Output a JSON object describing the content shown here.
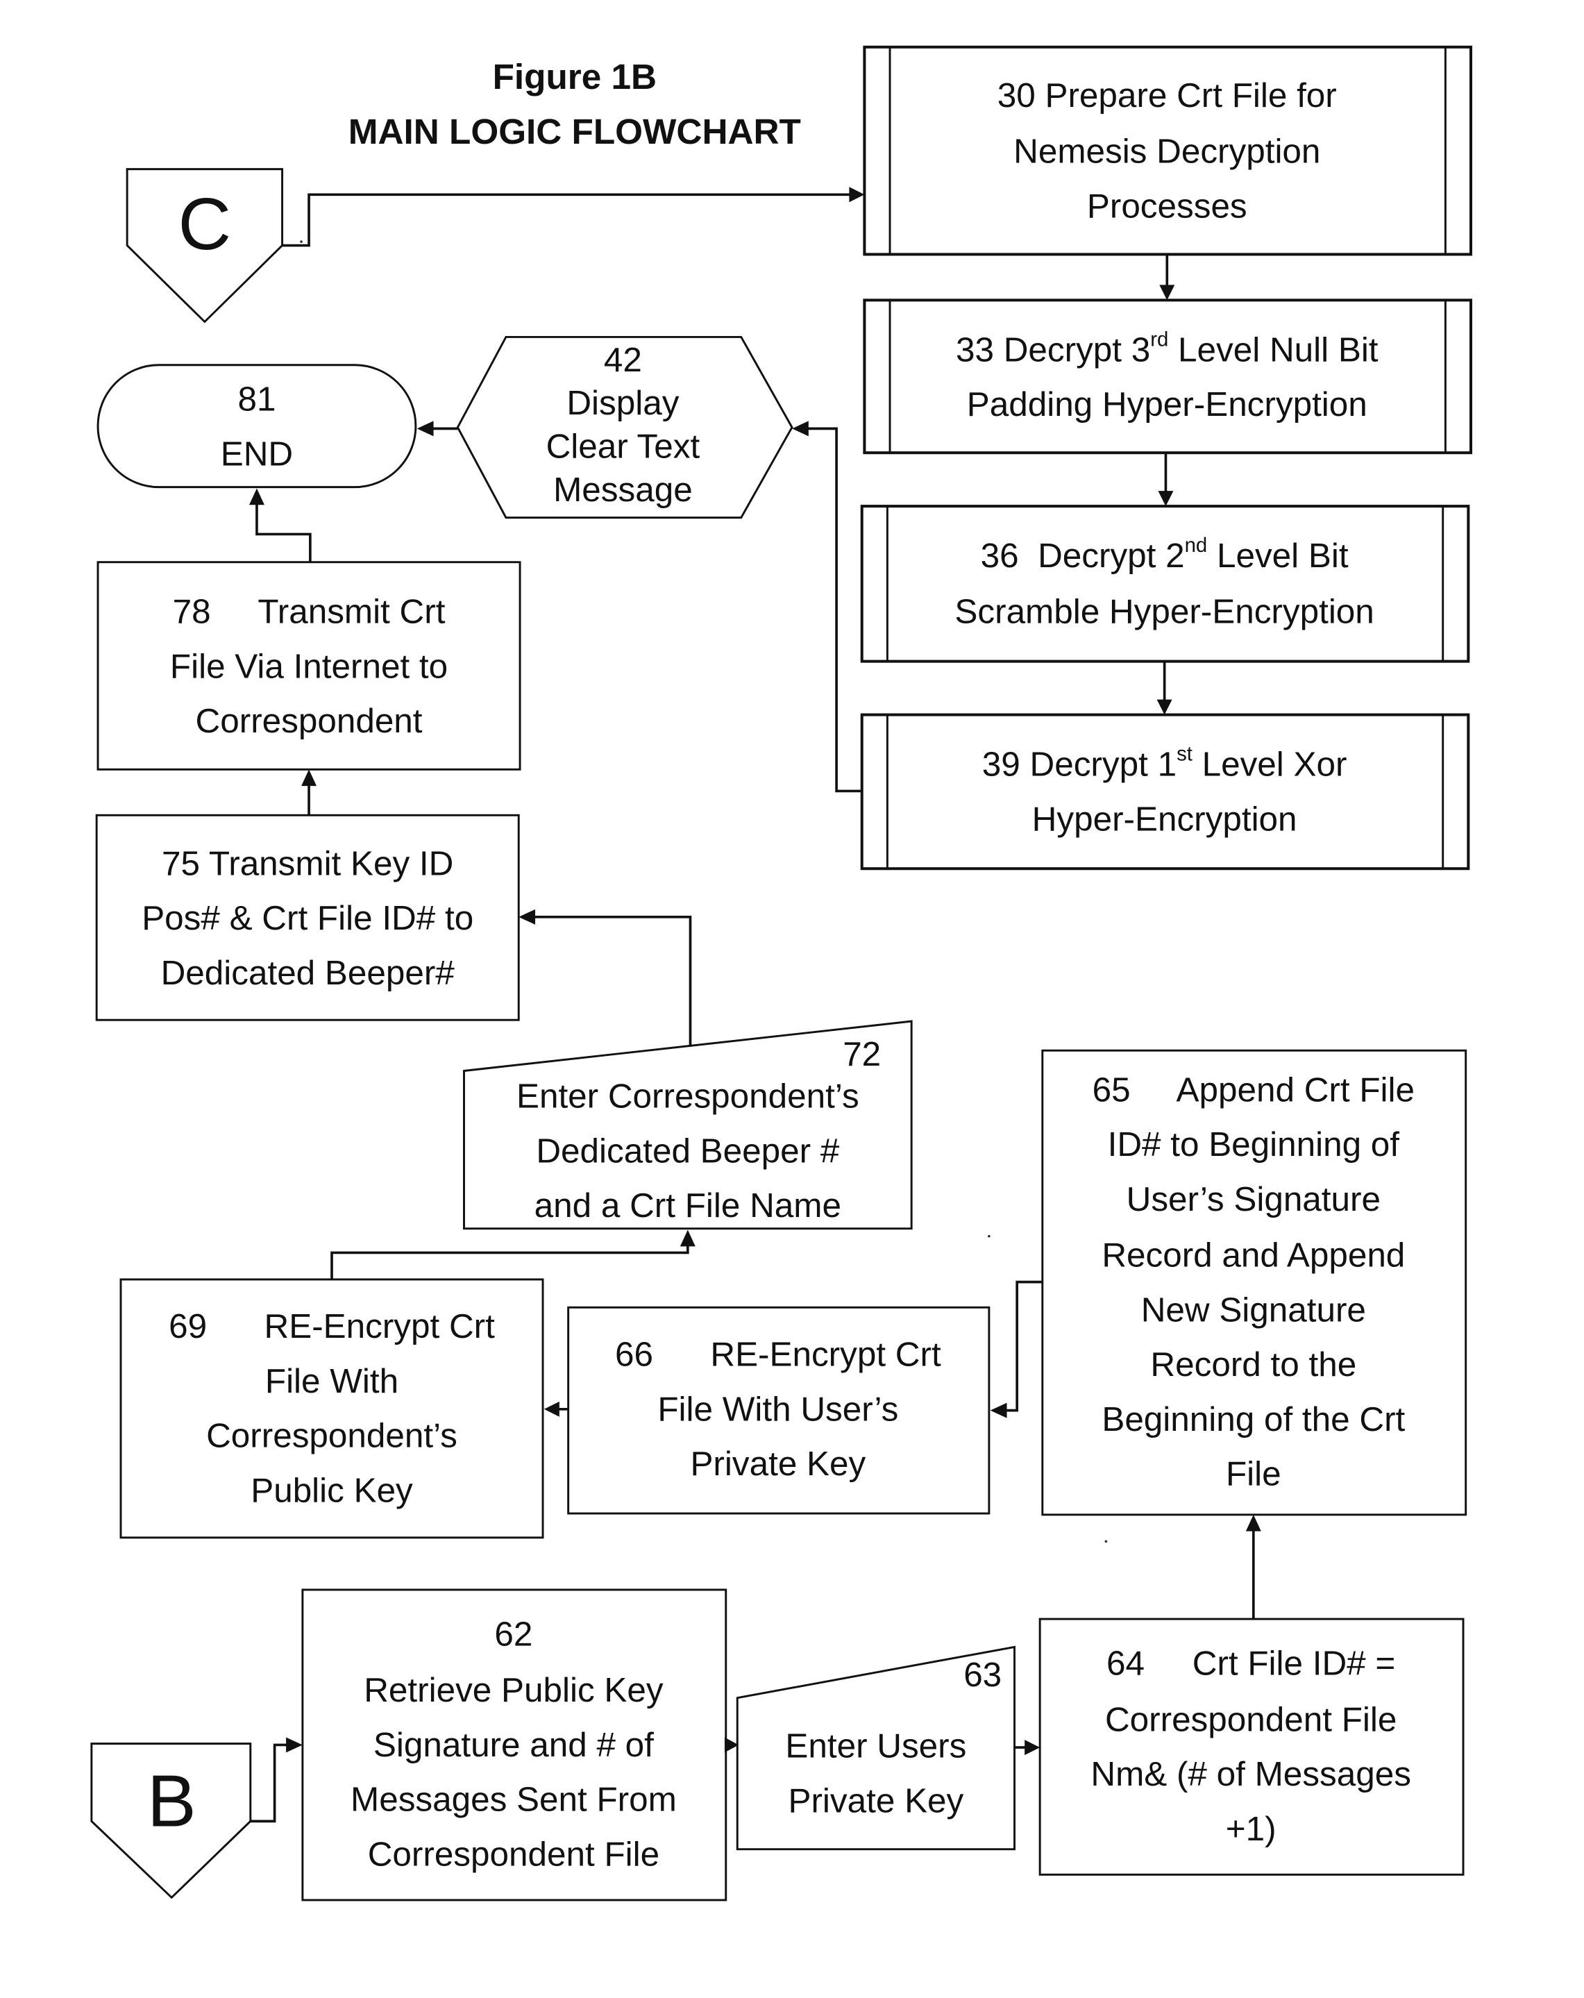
{
  "figure": {
    "title": "Figure 1B",
    "subtitle": "MAIN LOGIC FLOWCHART"
  },
  "connectors": {
    "c": {
      "label": "C"
    },
    "b": {
      "label": "B"
    }
  },
  "nodes": {
    "n30": {
      "id": "30",
      "type": "predefined-process",
      "lines": [
        "30 Prepare Crt File for",
        "Nemesis Decryption",
        "Processes"
      ]
    },
    "n33": {
      "id": "33",
      "type": "predefined-process",
      "line1_pre": "33 Decrypt 3",
      "line1_sup": "rd",
      "line1_post": " Level Null Bit",
      "line2": "Padding Hyper-Encryption"
    },
    "n36": {
      "id": "36",
      "type": "predefined-process",
      "line1_pre": "36  Decrypt 2",
      "line1_sup": "nd",
      "line1_post": " Level Bit",
      "line2": "Scramble Hyper-Encryption"
    },
    "n39": {
      "id": "39",
      "type": "predefined-process",
      "line1_pre": "39 Decrypt 1",
      "line1_sup": "st",
      "line1_post": " Level Xor",
      "line2": "Hyper-Encryption"
    },
    "n42": {
      "id": "42",
      "type": "display",
      "lines": [
        "42",
        "Display",
        "Clear Text",
        "Message"
      ]
    },
    "n81": {
      "id": "81",
      "type": "terminal",
      "lines": [
        "81",
        "END"
      ]
    },
    "n78": {
      "id": "78",
      "type": "process",
      "lines": [
        "78     Transmit Crt",
        "File Via Internet to",
        "Correspondent"
      ]
    },
    "n75": {
      "id": "75",
      "type": "process",
      "lines": [
        "75 Transmit Key ID",
        "Pos# & Crt File ID# to",
        "Dedicated Beeper#"
      ]
    },
    "n72": {
      "id": "72",
      "type": "manual-input",
      "number": "72",
      "lines": [
        "Enter Correspondent’s",
        "Dedicated Beeper #",
        "and a Crt File Name"
      ]
    },
    "n65": {
      "id": "65",
      "type": "process",
      "lines": [
        "65     Append Crt File",
        "ID# to Beginning of",
        "User’s Signature",
        "Record and Append",
        "New Signature",
        "Record to the",
        "Beginning of the Crt",
        "File"
      ]
    },
    "n69": {
      "id": "69",
      "type": "process",
      "lines": [
        "69      RE-Encrypt Crt",
        "File With",
        "Correspondent’s",
        "Public Key"
      ]
    },
    "n66": {
      "id": "66",
      "type": "process",
      "lines": [
        "66      RE-Encrypt Crt",
        "File With User’s",
        "Private Key"
      ]
    },
    "n62": {
      "id": "62",
      "type": "process",
      "lines": [
        "62",
        "Retrieve Public Key",
        "Signature and # of",
        "Messages Sent From",
        "Correspondent File"
      ]
    },
    "n63": {
      "id": "63",
      "type": "manual-input",
      "number": "63",
      "lines": [
        "Enter Users",
        "Private Key"
      ]
    },
    "n64": {
      "id": "64",
      "type": "process",
      "lines": [
        "64     Crt File ID# =",
        "Correspondent File",
        "Nm& (# of Messages",
        "+1)"
      ]
    }
  },
  "edges": [
    {
      "from": "C",
      "to": "30"
    },
    {
      "from": "30",
      "to": "33"
    },
    {
      "from": "33",
      "to": "36"
    },
    {
      "from": "36",
      "to": "39"
    },
    {
      "from": "39",
      "to": "42"
    },
    {
      "from": "42",
      "to": "81"
    },
    {
      "from": "B",
      "to": "62"
    },
    {
      "from": "62",
      "to": "63"
    },
    {
      "from": "63",
      "to": "64"
    },
    {
      "from": "64",
      "to": "65"
    },
    {
      "from": "65",
      "to": "66"
    },
    {
      "from": "66",
      "to": "69"
    },
    {
      "from": "69",
      "to": "72"
    },
    {
      "from": "72",
      "to": "75"
    },
    {
      "from": "75",
      "to": "78"
    },
    {
      "from": "78",
      "to": "81"
    }
  ]
}
